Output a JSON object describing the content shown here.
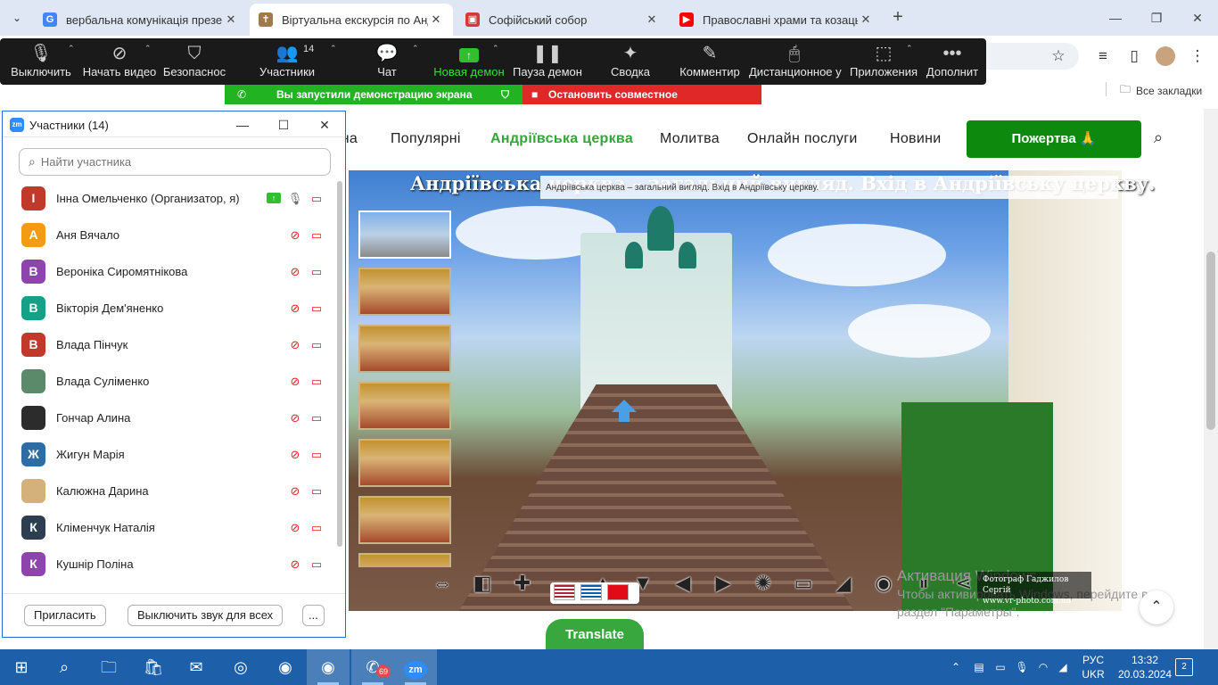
{
  "browser": {
    "tabs": [
      {
        "title": "вербальна комунікація презе",
        "favicon": "google-g",
        "color": "#4285f4"
      },
      {
        "title": "Віртуальна екскурсія по Андрі",
        "favicon": "site-icon",
        "color": "#8a6d3b"
      },
      {
        "title": "Софійський собор",
        "favicon": "site-red-icon",
        "color": "#d23a3a"
      },
      {
        "title": "Православні храми та козацьк",
        "favicon": "youtube-icon",
        "color": "#ff0000"
      }
    ],
    "bookmarks_all": "Все закладки"
  },
  "zoom_toolbar": {
    "buttons": [
      {
        "label": "Выключить",
        "icon": "mic-icon"
      },
      {
        "label": "Начать видео",
        "icon": "video-off-icon"
      },
      {
        "label": "Безопаснос",
        "icon": "shield-icon"
      },
      {
        "label": "Участники",
        "icon": "participants-icon",
        "count": "14"
      },
      {
        "label": "Чат",
        "icon": "chat-icon"
      },
      {
        "label": "Новая демон",
        "icon": "share-screen-icon"
      },
      {
        "label": "Пауза демон",
        "icon": "pause-icon"
      },
      {
        "label": "Сводка",
        "icon": "summary-icon"
      },
      {
        "label": "Комментир",
        "icon": "pen-icon"
      },
      {
        "label": "Дистанционное у",
        "icon": "remote-control-icon"
      },
      {
        "label": "Приложения",
        "icon": "apps-icon"
      },
      {
        "label": "Дополнит",
        "icon": "more-icon"
      }
    ],
    "share_banner": "Вы запустили демонстрацию экрана",
    "stop_share": "Остановить совместное использование"
  },
  "site": {
    "nav": [
      "вна",
      "Популярні",
      "Андріївська церква",
      "Молитва",
      "Онлайн послуги",
      "Новини"
    ],
    "donate": "Пожертва 🙏",
    "pano_title": "Андріївська церква – загальний вигляд. Вхід в Андріївську церкву.",
    "pano_caption": "Андріївська церква – загальний вигляд. Вхід в Андріївську церкву.",
    "photographer_line1": "Фотограф Гаджилов Сергій",
    "photographer_line2": "www.vr-photo.com.ua",
    "translate": "Translate",
    "activate_line1": "Активация Windows",
    "activate_line2": "Чтобы активировать Windows, перейдите в",
    "activate_line3": "раздел \"Параметры\"."
  },
  "participants": {
    "title": "Участники (14)",
    "search_placeholder": "Найти участника",
    "list": [
      {
        "name": "Інна Омельченко (Организатор, я)",
        "initial": "І",
        "color": "#c0392b",
        "host": true
      },
      {
        "name": "Аня Вячало",
        "initial": "А",
        "color": "#f39c12"
      },
      {
        "name": "Вероніка Сиромятнікова",
        "initial": "В",
        "color": "#8e44ad"
      },
      {
        "name": "Вікторія Дем'яненко",
        "initial": "В",
        "color": "#16a085"
      },
      {
        "name": "Влада Пінчук",
        "initial": "В",
        "color": "#c0392b"
      },
      {
        "name": "Влада Суліменко",
        "initial": "",
        "color": "#5a8a6a",
        "photo": true
      },
      {
        "name": "Гончар Алина",
        "initial": "",
        "color": "#2c2c2c",
        "photo": true
      },
      {
        "name": "Жигун Марія",
        "initial": "Ж",
        "color": "#2e6da4"
      },
      {
        "name": "Калюжна Дарина",
        "initial": "",
        "color": "#d4b07a",
        "photo": true
      },
      {
        "name": "Кліменчук Наталія",
        "initial": "К",
        "color": "#2c3e50"
      },
      {
        "name": "Кушнір Поліна",
        "initial": "К",
        "color": "#8e44ad"
      }
    ],
    "invite": "Пригласить",
    "mute_all": "Выключить звук для всех",
    "more": "..."
  },
  "taskbar": {
    "lang1": "РУС",
    "lang2": "UKR",
    "time": "13:32",
    "date": "20.03.2024",
    "notifications": "2",
    "viber_badge": "69"
  }
}
